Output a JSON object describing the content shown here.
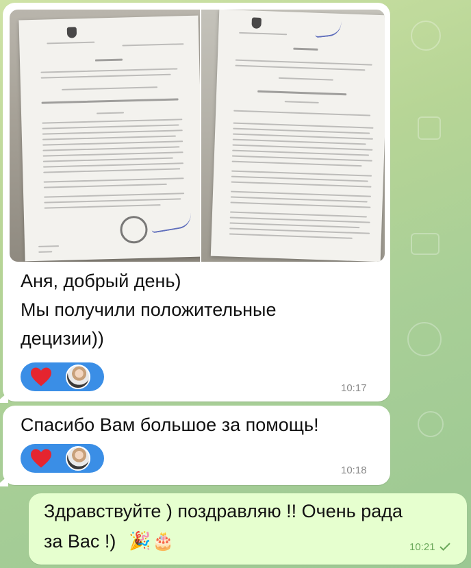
{
  "messages": [
    {
      "id": "msg-1",
      "direction": "incoming",
      "attachment": "two photographed official letters",
      "text_lines": [
        "Аня, добрый день)",
        "Мы получили положительные",
        "децизии))"
      ],
      "reactions": [
        "heart",
        "avatar"
      ],
      "time": "10:17"
    },
    {
      "id": "msg-2",
      "direction": "incoming",
      "text_lines": [
        "Спасибо Вам большое за помощь!"
      ],
      "reactions": [
        "heart",
        "avatar"
      ],
      "time": "10:18"
    },
    {
      "id": "msg-3",
      "direction": "outgoing",
      "text_lines": [
        "Здравствуйте ) поздравляю !! Очень рада",
        "за Вас !)"
      ],
      "emojis": [
        "🎉",
        "🎂"
      ],
      "time": "10:21",
      "status": "sent-check"
    }
  ],
  "colors": {
    "incoming_bubble": "#ffffff",
    "outgoing_bubble": "#e6ffcf",
    "reaction_pill": "#3a8ee6",
    "heart": "#e5252f",
    "timestamp": "#8a8a8a",
    "outgoing_timestamp": "#6aa85a"
  }
}
